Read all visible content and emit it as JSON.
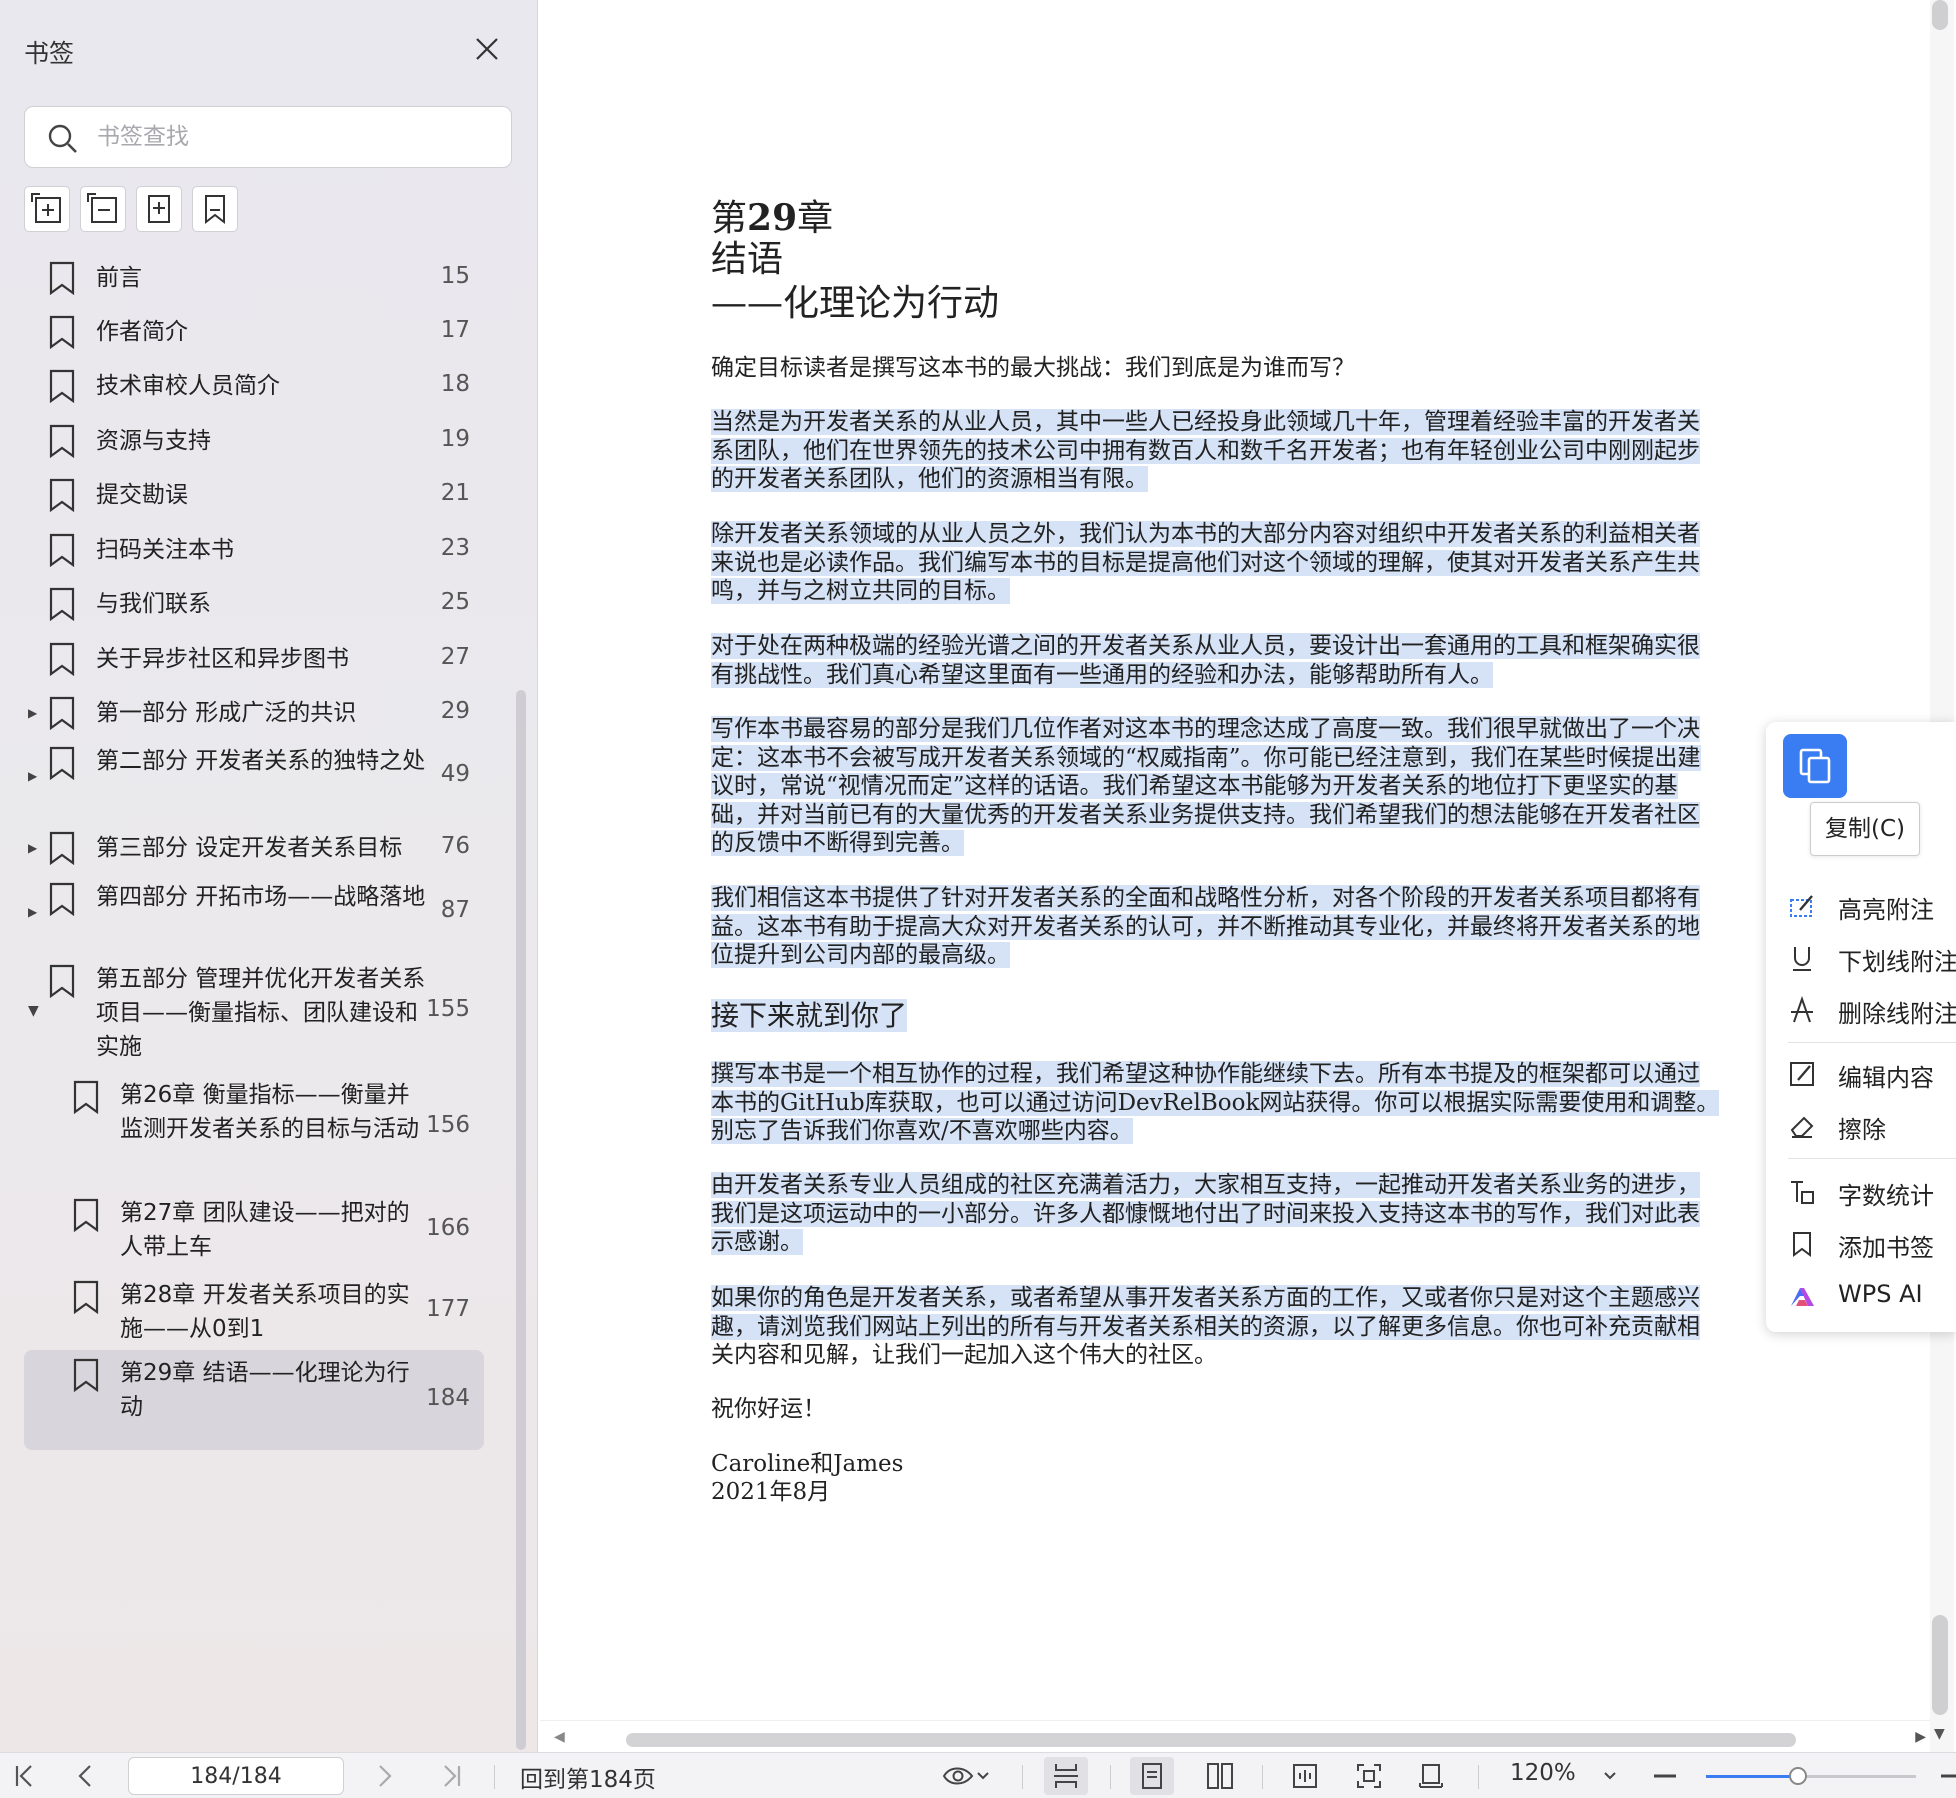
{
  "sidebar": {
    "title": "书签",
    "search_placeholder": "书签查找",
    "tool_icons": [
      "add-bookmark-icon",
      "collapse-all-icon",
      "insert-bookmark-icon",
      "bookmark-outline-icon"
    ],
    "items": [
      {
        "label": "前言",
        "page": "15"
      },
      {
        "label": "作者简介",
        "page": "17"
      },
      {
        "label": "技术审校人员简介",
        "page": "18"
      },
      {
        "label": "资源与支持",
        "page": "19"
      },
      {
        "label": "提交勘误",
        "page": "21"
      },
      {
        "label": "扫码关注本书",
        "page": "23"
      },
      {
        "label": "与我们联系",
        "page": "25"
      },
      {
        "label": "关于异步社区和异步图书",
        "page": "27"
      },
      {
        "label": "第一部分 形成广泛的共识",
        "page": "29",
        "arrow": "▶"
      },
      {
        "label": "第二部分 开发者关系的独特之处",
        "page": "49",
        "arrow": "▶"
      },
      {
        "label": "第三部分 设定开发者关系目标",
        "page": "76",
        "arrow": "▶"
      },
      {
        "label": "第四部分 开拓市场——战略落地",
        "page": "87",
        "arrow": "▶"
      },
      {
        "label": "第五部分 管理并优化开发者关系项目——衡量指标、团队建设和实施",
        "page": "155",
        "arrow": "▼"
      },
      {
        "label": "第26章 衡量指标——衡量并监测开发者关系的目标与活动",
        "page": "156"
      },
      {
        "label": "第27章 团队建设——把对的人带上车",
        "page": "166"
      },
      {
        "label": "第28章 开发者关系项目的实施——从0到1",
        "page": "177"
      },
      {
        "label": "第29章 结语——化理论为行动",
        "page": "184"
      }
    ]
  },
  "document": {
    "chapter_num_prefix": "第",
    "chapter_num": "29",
    "chapter_num_suffix": "章",
    "chapter_title": "结语",
    "chapter_subtitle": "——化理论为行动",
    "p0": "确定目标读者是撰写这本书的最大挑战：我们到底是为谁而写？",
    "p1": [
      "当然是为开发者关系的从业人员，其中一些人已经投身此领域几十年，管理着经验丰富的开发者关",
      "系团队，他们在世界领先的技术公司中拥有数百人和数千名开发者；也有年轻创业公司中刚刚起步",
      "的开发者关系团队，他们的资源相当有限。"
    ],
    "p2": [
      "除开发者关系领域的从业人员之外，我们认为本书的大部分内容对组织中开发者关系的利益相关者",
      "来说也是必读作品。我们编写本书的目标是提高他们对这个领域的理解，使其对开发者关系产生共",
      "鸣，并与之树立共同的目标。"
    ],
    "p3": [
      "对于处在两种极端的经验光谱之间的开发者关系从业人员，要设计出一套通用的工具和框架确实很",
      "有挑战性。我们真心希望这里面有一些通用的经验和办法，能够帮助所有人。"
    ],
    "p4": [
      "写作本书最容易的部分是我们几位作者对这本书的理念达成了高度一致。我们很早就做出了一个决",
      "定：这本书不会被写成开发者关系领域的“权威指南”。你可能已经注意到，我们在某些时候提出建",
      "议时，常说“视情况而定”这样的话语。我们希望这本书能够为开发者关系的地位打下更坚实的基",
      "础，并对当前已有的大量优秀的开发者关系业务提供支持。我们希望我们的想法能够在开发者社区",
      "的反馈中不断得到完善。"
    ],
    "p5": [
      "我们相信这本书提供了针对开发者关系的全面和战略性分析，对各个阶段的开发者关系项目都将有",
      "益。这本书有助于提高大众对开发者关系的认可，并不断推动其专业化，并最终将开发者关系的地",
      "位提升到公司内部的最高级。"
    ],
    "subhead": "接下来就到你了",
    "p6": [
      "撰写本书是一个相互协作的过程，我们希望这种协作能继续下去。所有本书提及的框架都可以通过",
      "本书的GitHub库获取，也可以通过访问DevRelBook网站获得。你可以根据实际需要使用和调整。",
      "别忘了告诉我们你喜欢/不喜欢哪些内容。"
    ],
    "p7": [
      "由开发者关系专业人员组成的社区充满着活力，大家相互支持，一起推动开发者关系业务的进步，",
      "我们是这项运动中的一小部分。许多人都慷慨地付出了时间来投入支持这本书的写作，我们对此表",
      "示感谢。"
    ],
    "p8": [
      "如果你的角色是开发者关系，或者希望从事开发者关系方面的工作，又或者你只是对这个主题感兴",
      "趣，请浏览我们网站上列出的所有与开发者关系相关的资源，以了解更多信息。你也可补充贡献相",
      "关内容和见解，让我们一起加入这个伟大的社区。"
    ],
    "closing": "祝你好运！",
    "sign1": "Caroline和James",
    "sign2": "2021年8月"
  },
  "context_menu": {
    "copy_tooltip": "复制(C)",
    "items": [
      {
        "label": "高亮附注",
        "icon": "highlight-note-icon"
      },
      {
        "label": "下划线附注",
        "icon": "underline-note-icon"
      },
      {
        "label": "删除线附注",
        "icon": "strikethrough-note-icon"
      },
      {
        "label": "编辑内容",
        "icon": "edit-content-icon"
      },
      {
        "label": "擦除",
        "icon": "eraser-icon"
      },
      {
        "label": "字数统计",
        "icon": "word-count-icon"
      },
      {
        "label": "添加书签",
        "icon": "add-bookmark-icon"
      },
      {
        "label": "WPS AI",
        "icon": "wps-ai-icon"
      }
    ]
  },
  "statusbar": {
    "page_value": "184/184",
    "back_to_page": "回到第184页",
    "zoom": "120%",
    "zoom_level": 0.44
  },
  "colors": {
    "accent": "#3a7df2",
    "selection": "#d6e2f6",
    "sidebar_selected": "#d8d6dc"
  }
}
